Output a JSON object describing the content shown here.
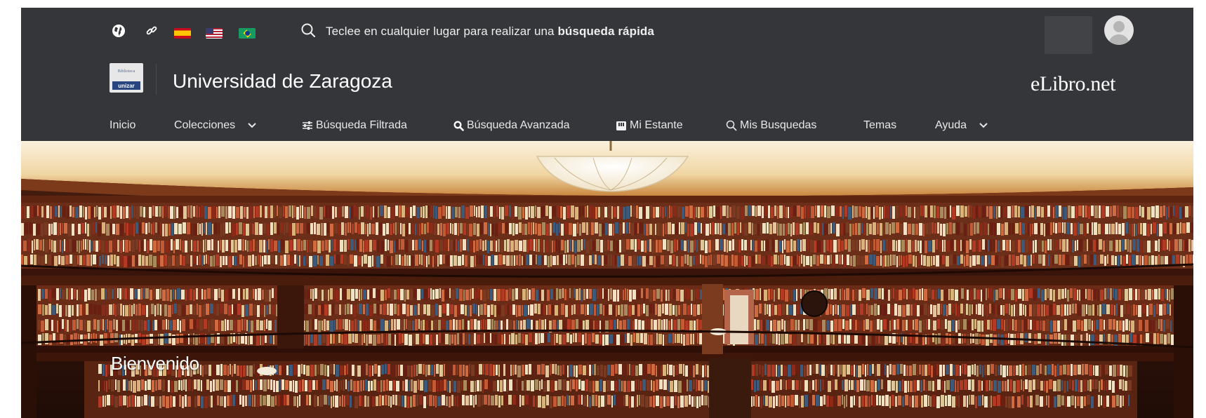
{
  "languages": [
    {
      "name": "Español",
      "icon": "spain-flag-icon"
    },
    {
      "name": "English",
      "icon": "us-flag-icon"
    },
    {
      "name": "Português",
      "icon": "brazil-flag-icon"
    }
  ],
  "quick_search": {
    "prefix": "Teclee en cualquier lugar para realizar una",
    "bold": "búsqueda rápida"
  },
  "brand": {
    "logo_top": "Biblioteca",
    "logo_band": "unizar",
    "institution": "Universidad de Zaragoza",
    "platform": "eLibro.net"
  },
  "nav": {
    "inicio": "Inicio",
    "colecciones": "Colecciones",
    "busqueda_filtrada": "Búsqueda Filtrada",
    "busqueda_avanzada": "Búsqueda Avanzada",
    "mi_estante": "Mi Estante",
    "mis_busquedas": "Mis Busquedas",
    "temas": "Temas",
    "ayuda": "Ayuda"
  },
  "hero": {
    "welcome": "Bienvenido"
  },
  "colors": {
    "header_bg": "#353639",
    "text": "#ffffff",
    "shelf_wood": "#6b2e18",
    "ceiling": "#f3dfb8"
  }
}
